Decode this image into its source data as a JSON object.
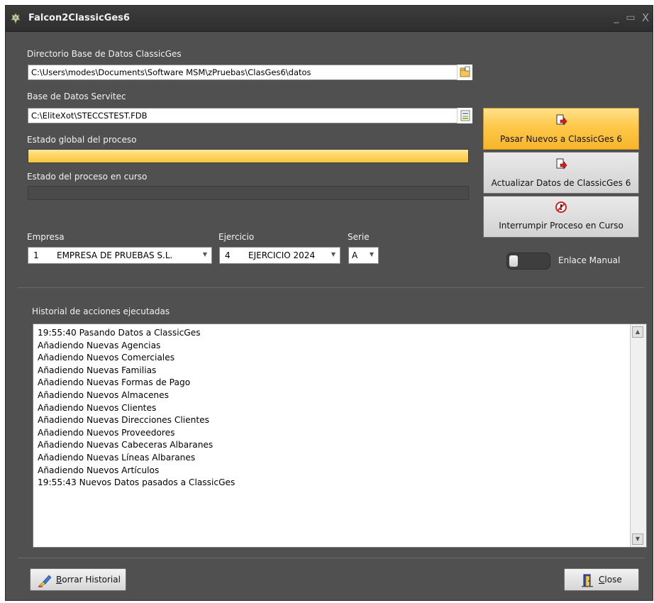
{
  "window": {
    "title": "Falcon2ClassicGes6",
    "minimize": "_",
    "maximize": "▭",
    "close": "X"
  },
  "classicges_dir": {
    "label": "Directorio Base de Datos ClassicGes",
    "value": "C:\\Users\\modes\\Documents\\Software MSM\\zPruebas\\ClasGes6\\datos"
  },
  "servitec_db": {
    "label": "Base de Datos Servitec",
    "value": "C:\\EliteXot\\STECCSTEST.FDB"
  },
  "global_progress": {
    "label": "Estado global del proceso",
    "value": 1.0
  },
  "current_progress": {
    "label": "Estado del proceso en curso",
    "value": 0.0
  },
  "empresa": {
    "label": "Empresa",
    "code": "1",
    "name": "EMPRESA DE PRUEBAS S.L."
  },
  "ejercicio": {
    "label": "Ejercicio",
    "code": "4",
    "name": "EJERCICIO 2024"
  },
  "serie": {
    "label": "Serie",
    "value": "A"
  },
  "actions": {
    "pasar_nuevos": "Pasar Nuevos a ClassicGes 6",
    "actualizar": "Actualizar Datos de ClassicGes 6",
    "interrumpir": "Interrumpir Proceso en Curso"
  },
  "enlace_manual": {
    "label": "Enlace Manual",
    "on": false
  },
  "history": {
    "label": "Historial de acciones ejecutadas",
    "lines": [
      "19:55:40 Pasando Datos a ClassicGes",
      "Añadiendo Nuevas Agencias",
      "Añadiendo Nuevos Comerciales",
      "Añadiendo Nuevas Familias",
      "Añadiendo Nuevas Formas de Pago",
      "Añadiendo Nuevos Almacenes",
      "Añadiendo Nuevos Clientes",
      "Añadiendo Nuevas Direcciones Clientes",
      "Añadiendo Nuevos Proveedores",
      "Añadiendo Nuevas Cabeceras Albaranes",
      "Añadiendo Nuevas Líneas Albaranes",
      "Añadiendo Nuevos Artículos",
      "19:55:43 Nuevos Datos pasados a ClassicGes"
    ]
  },
  "buttons": {
    "clear_history": "Borrar Historial",
    "close": "Close"
  },
  "icons": {
    "app": "game-piece-icon",
    "folder": "folder-open-icon",
    "database": "database-file-icon",
    "export": "document-export-icon",
    "stop": "stop-icon",
    "eraser": "eraser-icon",
    "door": "door-exit-icon"
  },
  "colors": {
    "accent": "#ffc84a",
    "window_bg": "#505050",
    "titlebar": "#333333"
  }
}
